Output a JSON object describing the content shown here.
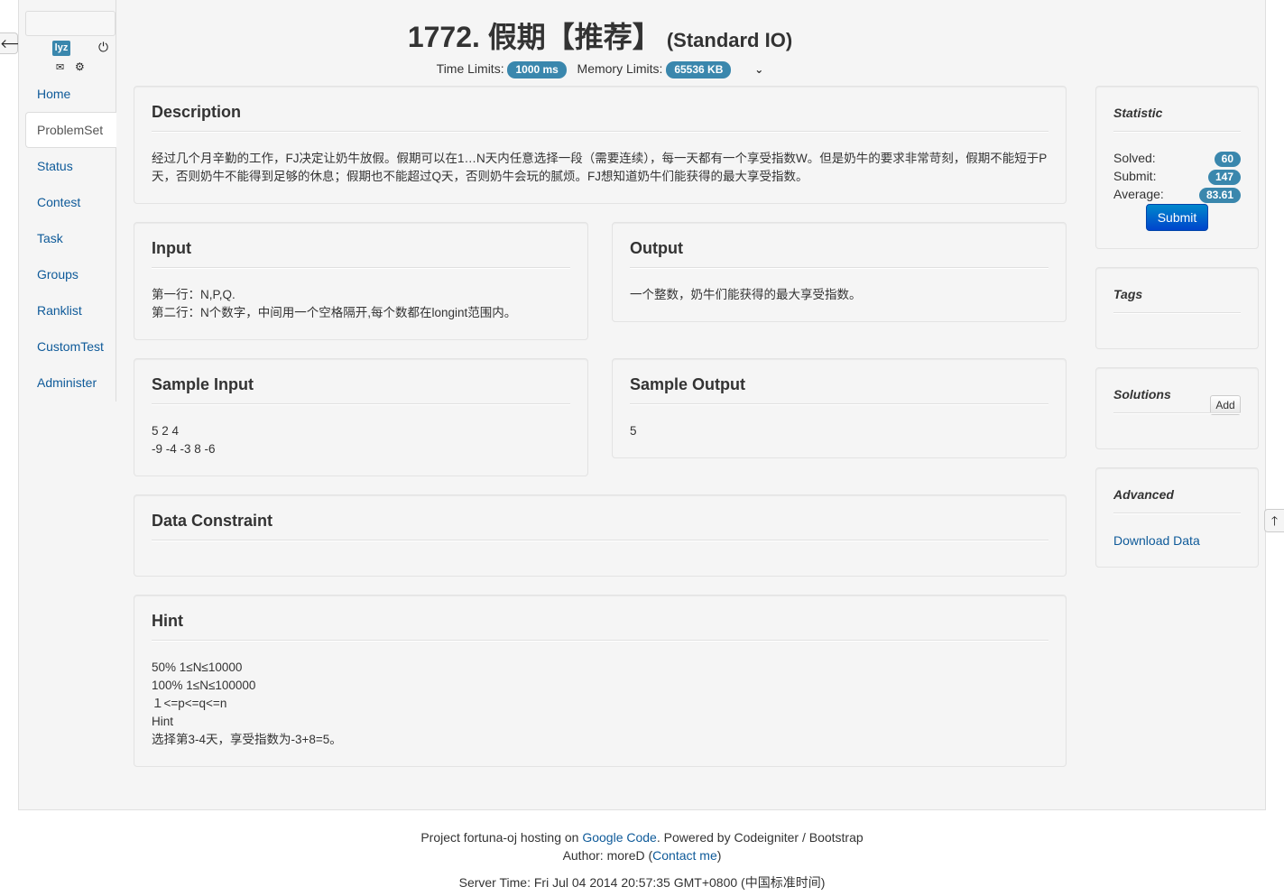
{
  "sidebar": {
    "user": "lyz",
    "items": [
      {
        "label": "Home"
      },
      {
        "label": "ProblemSet"
      },
      {
        "label": "Status"
      },
      {
        "label": "Contest"
      },
      {
        "label": "Task"
      },
      {
        "label": "Groups"
      },
      {
        "label": "Ranklist"
      },
      {
        "label": "CustomTest"
      },
      {
        "label": "Administer"
      }
    ],
    "active_item": "ProblemSet"
  },
  "problem": {
    "title": "1772. 假期【推荐】",
    "io": "(Standard IO)",
    "time_label": "Time Limits:",
    "time_value": "1000 ms",
    "memory_label": "Memory Limits:",
    "memory_value": "65536 KB"
  },
  "sections": {
    "description": {
      "title": "Description",
      "text": "经过几个月辛勤的工作，FJ决定让奶牛放假。假期可以在1…N天内任意选择一段（需要连续），每一天都有一个享受指数W。但是奶牛的要求非常苛刻，假期不能短于P天，否则奶牛不能得到足够的休息；假期也不能超过Q天，否则奶牛会玩的腻烦。FJ想知道奶牛们能获得的最大享受指数。"
    },
    "input": {
      "title": "Input",
      "lines": [
        "第一行：N,P,Q.",
        "第二行：N个数字，中间用一个空格隔开,每个数都在longint范围内。"
      ]
    },
    "output": {
      "title": "Output",
      "lines": [
        "一个整数，奶牛们能获得的最大享受指数。"
      ]
    },
    "sample_input": {
      "title": "Sample Input",
      "lines": [
        "5 2 4",
        "-9 -4 -3 8 -6"
      ]
    },
    "sample_output": {
      "title": "Sample Output",
      "lines": [
        "5"
      ]
    },
    "data_constraint": {
      "title": "Data Constraint"
    },
    "hint": {
      "title": "Hint",
      "lines": [
        "50% 1≤N≤10000",
        "100% 1≤N≤100000",
        "１<=p<=q<=n",
        "Hint",
        "选择第3-4天，享受指数为-3+8=5。"
      ]
    }
  },
  "statistic": {
    "title": "Statistic",
    "solved_label": "Solved:",
    "solved": "60",
    "submit_label": "Submit:",
    "submit": "147",
    "average_label": "Average:",
    "average": "83.61",
    "submit_button": "Submit"
  },
  "tags": {
    "title": "Tags"
  },
  "solutions": {
    "title": "Solutions",
    "add_button": "Add"
  },
  "advanced": {
    "title": "Advanced",
    "download": "Download Data"
  },
  "footer": {
    "line1_prefix": "Project fortuna-oj hosting on ",
    "line1_link": "Google Code",
    "line1_suffix": ". Powered by Codeigniter / Bootstrap",
    "line2_prefix": "Author: moreD (",
    "line2_link": "Contact me",
    "line2_suffix": ")",
    "server_time": "Server Time: Fri Jul 04 2014 20:57:35 GMT+0800 (中国标准时间)"
  }
}
